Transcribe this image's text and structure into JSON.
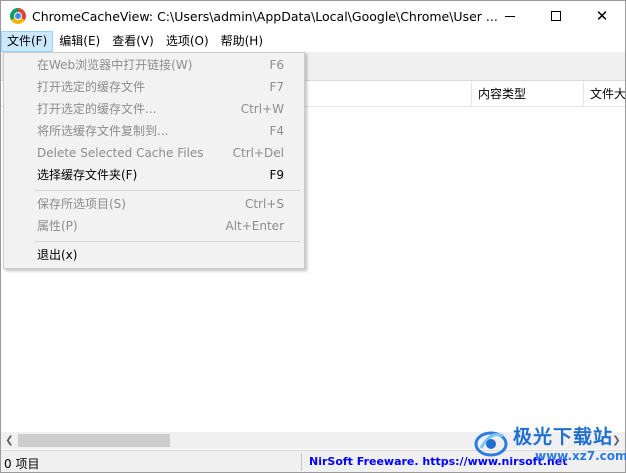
{
  "window": {
    "title": "ChromeCacheView:   C:\\Users\\admin\\AppData\\Local\\Google\\Chrome\\User ...",
    "minimize_icon": "minimize-icon",
    "maximize_icon": "maximize-icon",
    "close_glyph": "✕"
  },
  "menubar": {
    "items": [
      {
        "label": "文件(F)",
        "active": true
      },
      {
        "label": "编辑(E)"
      },
      {
        "label": "查看(V)"
      },
      {
        "label": "选项(O)"
      },
      {
        "label": "帮助(H)"
      }
    ]
  },
  "file_menu": {
    "items": [
      {
        "label": "在Web浏览器中打开链接(W)",
        "shortcut": "F6",
        "enabled": false
      },
      {
        "label": "打开选定的缓存文件",
        "shortcut": "F7",
        "enabled": false
      },
      {
        "label": "打开选定的缓存文件...",
        "shortcut": "Ctrl+W",
        "enabled": false
      },
      {
        "label": "将所选缓存文件复制到...",
        "shortcut": "F4",
        "enabled": false
      },
      {
        "label": "Delete Selected Cache Files",
        "shortcut": "Ctrl+Del",
        "enabled": false
      },
      {
        "label": "选择缓存文件夹(F)",
        "shortcut": "F9",
        "enabled": true
      },
      {
        "label": "保存所选项目(S)",
        "shortcut": "Ctrl+S",
        "enabled": false
      },
      {
        "label": "属性(P)",
        "shortcut": "Alt+Enter",
        "enabled": false
      },
      {
        "label": "退出(x)",
        "shortcut": "",
        "enabled": true
      }
    ]
  },
  "listview": {
    "columns": [
      "内容类型",
      "文件大"
    ]
  },
  "scrollbar": {
    "left_arrow": "❮",
    "right_arrow": "❯"
  },
  "statusbar": {
    "count": "0 项目",
    "link": "NirSoft Freeware. https://www.nirsoft.net"
  },
  "watermark": {
    "brand": "极光下载站",
    "url": "www.xz7.com"
  },
  "colors": {
    "menu_active_bg": "#cce8ff",
    "link": "#0000ff",
    "disabled_text": "#8d8d8d",
    "watermark_blue": "#1f6fd1"
  }
}
